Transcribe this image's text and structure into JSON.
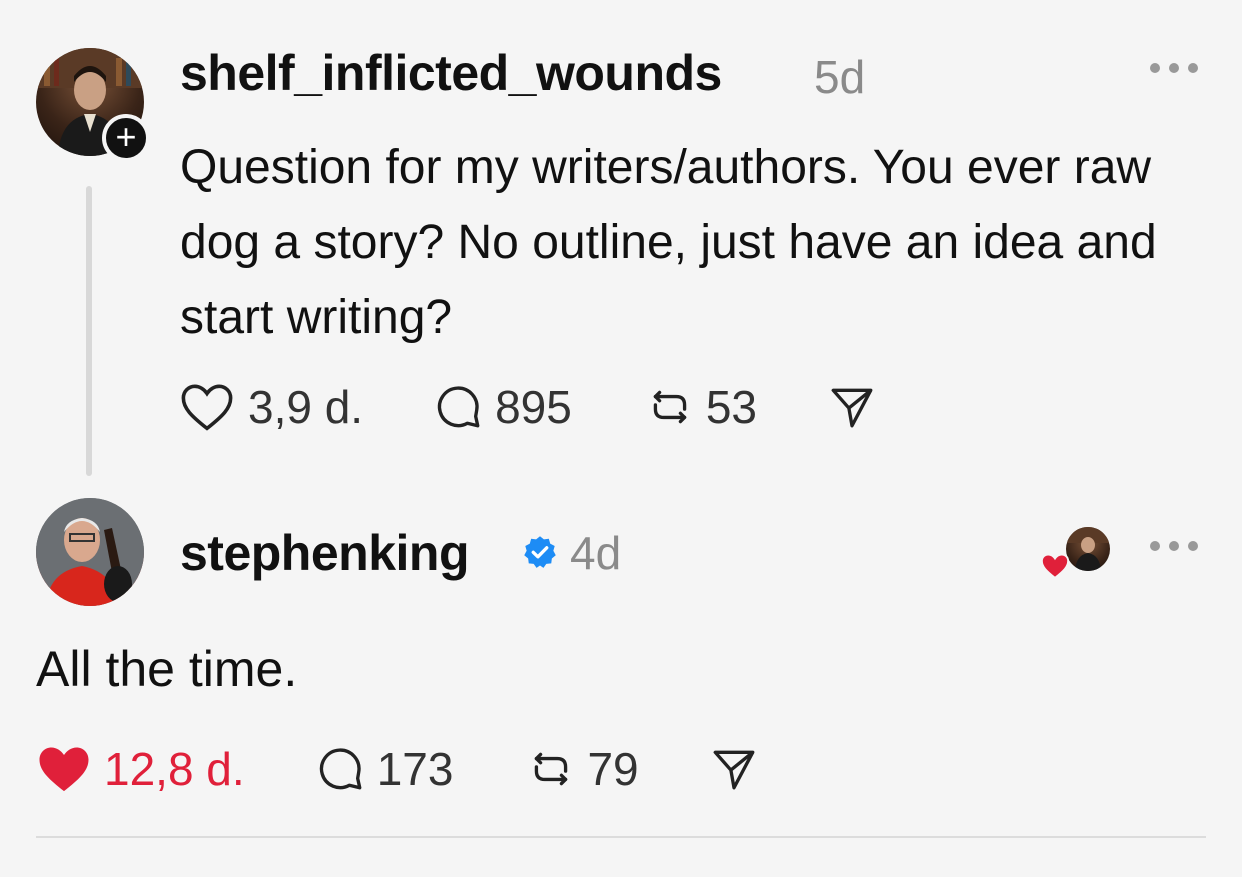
{
  "post": {
    "username": "shelf_inflicted_wounds",
    "time": "5d",
    "text": "Question for my writers/authors. You ever raw dog a story? No outline, just have an idea and start writing?",
    "likes": "3,9 d.",
    "replies": "895",
    "reposts": "53",
    "follow_symbol": "+"
  },
  "reply": {
    "username": "stephenking",
    "time": "4d",
    "text": "All the time.",
    "likes": "12,8 d.",
    "replies": "173",
    "reposts": "79"
  },
  "colors": {
    "liked": "#e0203a",
    "verified": "#1d8cf5",
    "muted": "#8a8a8a"
  },
  "icons": [
    "heart-icon",
    "comment-icon",
    "repost-icon",
    "share-icon",
    "more-icon",
    "verified-icon"
  ]
}
